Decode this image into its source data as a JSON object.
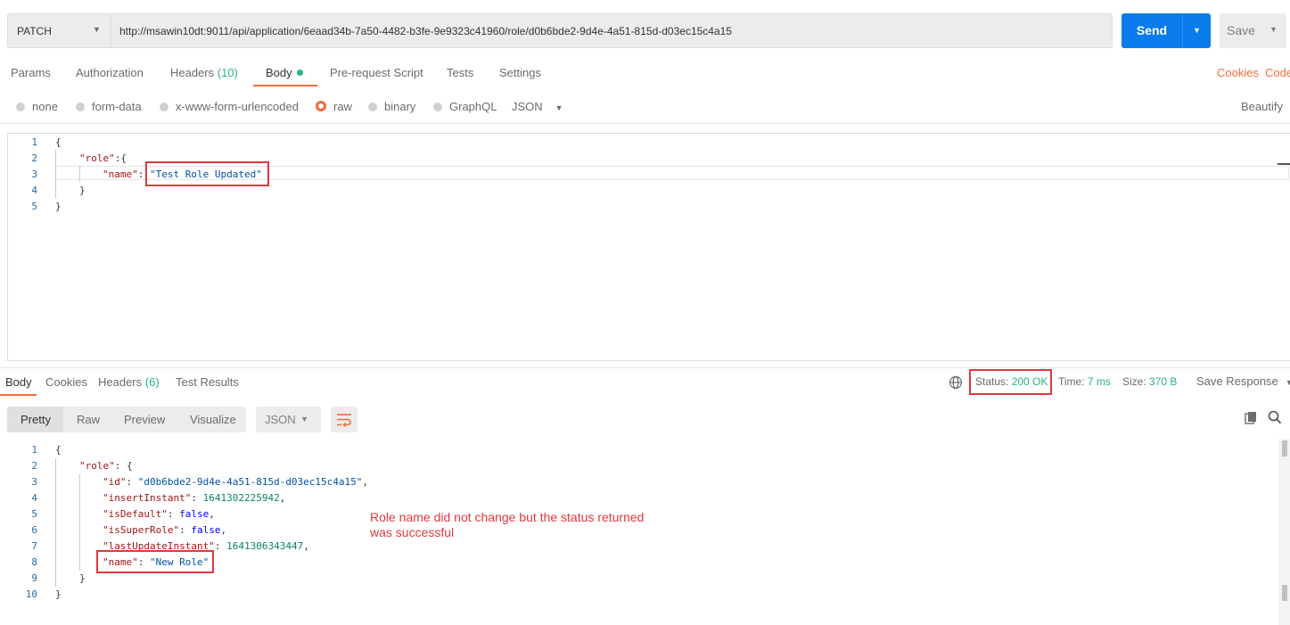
{
  "request": {
    "method": "PATCH",
    "url": "http://msawin10dt:9011/api/application/6eaad34b-7a50-4482-b3fe-9e9323c41960/role/d0b6bde2-9d4e-4a51-815d-d03ec15c4a15",
    "send_label": "Send",
    "save_label": "Save"
  },
  "request_tabs": {
    "params": "Params",
    "authorization": "Authorization",
    "headers": "Headers",
    "headers_count": "(10)",
    "body": "Body",
    "prerequest": "Pre-request Script",
    "tests": "Tests",
    "settings": "Settings",
    "cookies": "Cookies",
    "code": "Code"
  },
  "body_types": {
    "none": "none",
    "form_data": "form-data",
    "urlencoded": "x-www-form-urlencoded",
    "raw": "raw",
    "binary": "binary",
    "graphql": "GraphQL",
    "format": "JSON",
    "beautify": "Beautify",
    "selected": "raw"
  },
  "request_body": {
    "line_numbers": [
      "1",
      "2",
      "3",
      "4",
      "5"
    ],
    "l1": "{",
    "l2_key": "\"role\"",
    "l2_rest": ":{",
    "l3_key": "\"name\"",
    "l3_colon": ": ",
    "l3_value": "\"Test Role Updated\"",
    "l4": "}",
    "l5": "}"
  },
  "response_tabs": {
    "body": "Body",
    "cookies": "Cookies",
    "headers": "Headers",
    "headers_count": "(6)",
    "test_results": "Test Results"
  },
  "response_meta": {
    "status_label": "Status:",
    "status_value": "200 OK",
    "time_label": "Time:",
    "time_value": "7 ms",
    "size_label": "Size:",
    "size_value": "370 B",
    "save_response": "Save Response"
  },
  "response_view": {
    "pretty": "Pretty",
    "raw": "Raw",
    "preview": "Preview",
    "visualize": "Visualize",
    "format": "JSON"
  },
  "response_body": {
    "line_numbers": [
      "1",
      "2",
      "3",
      "4",
      "5",
      "6",
      "7",
      "8",
      "9",
      "10"
    ],
    "l1": "{",
    "l2_key": "\"role\"",
    "l2_rest": ": {",
    "l3_key": "\"id\"",
    "l3_value": "\"d0b6bde2-9d4e-4a51-815d-d03ec15c4a15\"",
    "l4_key": "\"insertInstant\"",
    "l4_value": "1641302225942",
    "l5_key": "\"isDefault\"",
    "l5_value": "false",
    "l6_key": "\"isSuperRole\"",
    "l6_value": "false",
    "l7_key": "\"lastUpdateInstant\"",
    "l7_value": "1641306343447",
    "l8_key": "\"name\"",
    "l8_value": "\"New Role\"",
    "l9": "}",
    "l10": "}",
    "colon": ": ",
    "comma": ","
  },
  "annotation": {
    "line1": "Role name did not change but the status returned",
    "line2": "was successful"
  },
  "colors": {
    "accent_orange": "#f26b3a",
    "send_blue": "#097bed",
    "status_green": "#26b47f",
    "annotation_red": "#e0383e"
  },
  "icons": [
    "globe-icon",
    "copy-icon",
    "search-icon",
    "wrap-lines-icon",
    "chevron-down-icon"
  ]
}
